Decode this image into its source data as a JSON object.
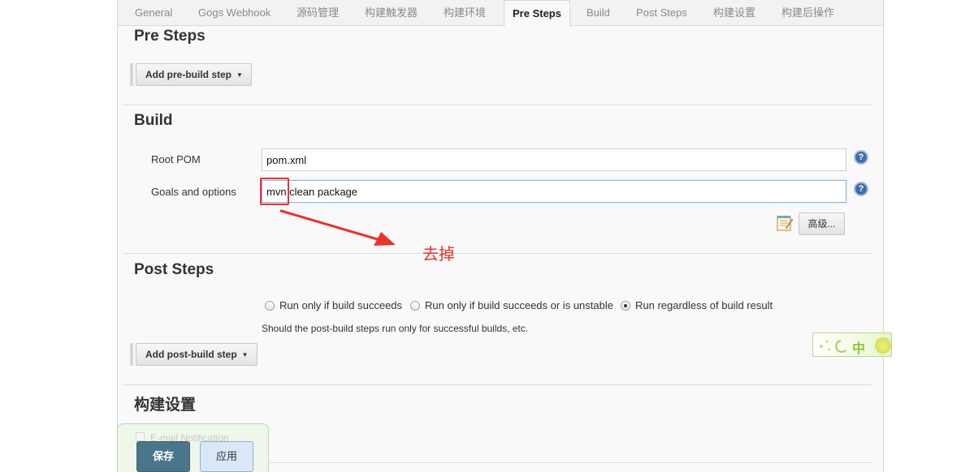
{
  "tabs": [
    {
      "label": "General"
    },
    {
      "label": "Gogs Webhook"
    },
    {
      "label": "源码管理"
    },
    {
      "label": "构建触发器"
    },
    {
      "label": "构建环境"
    },
    {
      "label": "Pre Steps"
    },
    {
      "label": "Build"
    },
    {
      "label": "Post Steps"
    },
    {
      "label": "构建设置"
    },
    {
      "label": "构建后操作"
    }
  ],
  "active_tab": "Pre Steps",
  "pre_steps": {
    "title": "Pre Steps",
    "add_button": "Add pre-build step"
  },
  "build": {
    "title": "Build",
    "root_pom_label": "Root POM",
    "root_pom_value": "pom.xml",
    "goals_label": "Goals and options",
    "goals_value": "mvn clean package",
    "advanced_button": "高级..."
  },
  "annotation": {
    "text": "去掉",
    "color": "#e8332e"
  },
  "post_steps": {
    "title": "Post Steps",
    "options": [
      {
        "label": "Run only if build succeeds",
        "checked": false
      },
      {
        "label": "Run only if build succeeds or is unstable",
        "checked": false
      },
      {
        "label": "Run regardless of build result",
        "checked": true
      }
    ],
    "hint": "Should the post-build steps run only for successful builds, etc.",
    "add_button": "Add post-build step"
  },
  "build_settings": {
    "title": "构建设置",
    "email_notification": "E-mail Notification"
  },
  "widget": {
    "label": "中"
  },
  "actions": {
    "save": "保存",
    "apply": "应用"
  },
  "colors": {
    "save_button": "#4b758b",
    "apply_button": "#d9e7f7",
    "help_icon": "#3f6ea9"
  }
}
